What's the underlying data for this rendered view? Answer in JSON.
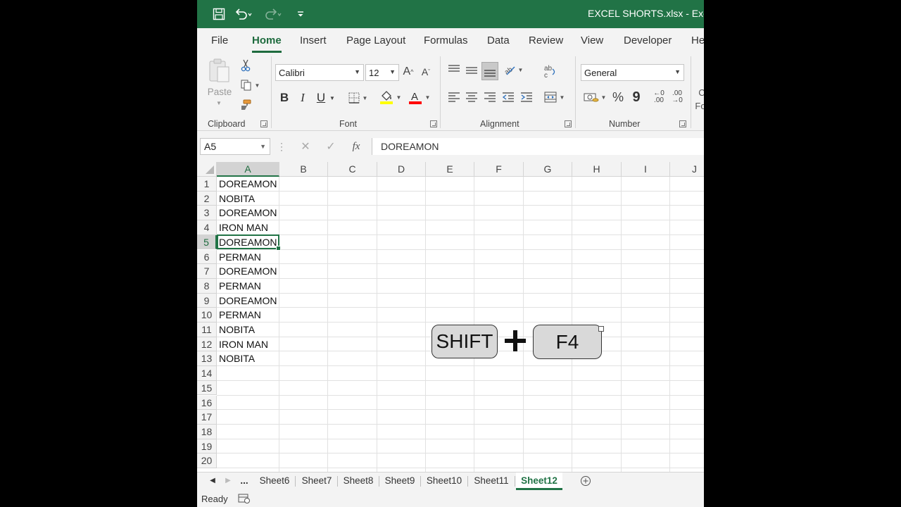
{
  "titlebar": {
    "title": "EXCEL SHORTS.xlsx  -  Exce"
  },
  "tabs": [
    "File",
    "Home",
    "Insert",
    "Page Layout",
    "Formulas",
    "Data",
    "Review",
    "View",
    "Developer",
    "He"
  ],
  "ribbon": {
    "clipboard": {
      "label": "Clipboard",
      "paste_label": "Paste"
    },
    "font": {
      "label": "Font",
      "name": "Calibri",
      "size": "12",
      "bold": "B",
      "italic": "I",
      "underline": "U"
    },
    "alignment": {
      "label": "Alignment"
    },
    "number": {
      "label": "Number",
      "format": "General",
      "percent": "%",
      "comma": "9",
      "inc_decimal": ".00",
      "dec_decimal": ".00"
    },
    "styles": {
      "partial_c": "C",
      "partial_fo": "Fo"
    },
    "colors": {
      "accent": "#217346",
      "highlight": "#ffff00",
      "font_color": "#ff0000"
    }
  },
  "formula_bar": {
    "name_box": "A5",
    "fx": "fx",
    "content": "DOREAMON"
  },
  "grid": {
    "columns": [
      "A",
      "B",
      "C",
      "D",
      "E",
      "F",
      "G",
      "H",
      "I",
      "J"
    ],
    "rows": [
      "1",
      "2",
      "3",
      "4",
      "5",
      "6",
      "7",
      "8",
      "9",
      "10",
      "11",
      "12",
      "13",
      "14",
      "15",
      "16",
      "17",
      "18",
      "19",
      "20"
    ],
    "cells_a": [
      "DOREAMON",
      "NOBITA",
      "DOREAMON",
      "IRON MAN",
      "DOREAMON",
      "PERMAN",
      "DOREAMON",
      "PERMAN",
      "DOREAMON",
      "PERMAN",
      "NOBITA",
      "IRON MAN",
      "NOBITA"
    ],
    "active_row": 5
  },
  "overlay": {
    "key1": "SHIFT",
    "key2": "F4"
  },
  "sheets": {
    "more": "...",
    "tabs": [
      "Sheet6",
      "Sheet7",
      "Sheet8",
      "Sheet9",
      "Sheet10",
      "Sheet11",
      "Sheet12"
    ],
    "active": "Sheet12"
  },
  "status": {
    "text": "Ready"
  }
}
